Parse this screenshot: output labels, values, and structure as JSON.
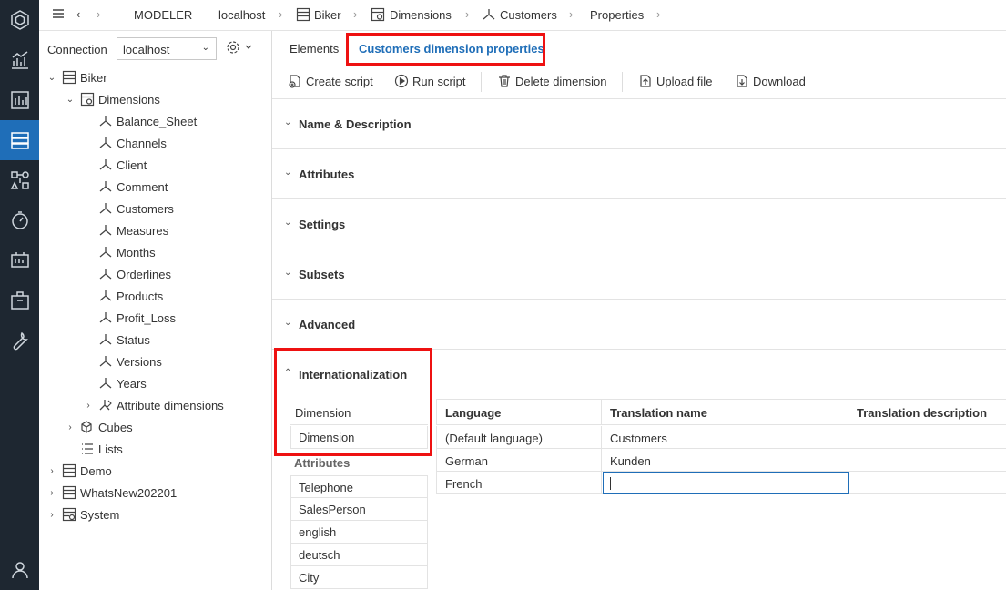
{
  "rail": {
    "items": [
      {
        "icon": "hexagon-logo-icon"
      },
      {
        "icon": "analytics-icon"
      },
      {
        "icon": "reports-icon"
      },
      {
        "icon": "modeler-icon",
        "active": true
      },
      {
        "icon": "designer-icon"
      },
      {
        "icon": "monitor-icon"
      },
      {
        "icon": "storyboard-icon"
      },
      {
        "icon": "package-icon"
      },
      {
        "icon": "tools-icon"
      },
      {
        "icon": "user-icon"
      }
    ]
  },
  "breadcrumb": {
    "modeler": "MODELER",
    "server": "localhost",
    "database": "Biker",
    "folder": "Dimensions",
    "dimension": "Customers",
    "page": "Properties"
  },
  "connection": {
    "label": "Connection",
    "value": "localhost"
  },
  "tree": {
    "biker": "Biker",
    "dimensions": "Dimensions",
    "dims": [
      "Balance_Sheet",
      "Channels",
      "Client",
      "Comment",
      "Customers",
      "Measures",
      "Months",
      "Orderlines",
      "Products",
      "Profit_Loss",
      "Status",
      "Versions",
      "Years"
    ],
    "attribute_dimensions": "Attribute dimensions",
    "cubes": "Cubes",
    "lists": "Lists",
    "demo": "Demo",
    "whatsnew": "WhatsNew202201",
    "system": "System"
  },
  "tabs": {
    "elements": "Elements",
    "properties": "Customers dimension properties"
  },
  "toolbar": {
    "create_script": "Create script",
    "run_script": "Run script",
    "delete_dimension": "Delete dimension",
    "upload_file": "Upload file",
    "download": "Download"
  },
  "sections": {
    "name_desc": "Name & Description",
    "attributes": "Attributes",
    "settings": "Settings",
    "subsets": "Subsets",
    "advanced": "Advanced",
    "internationalization": "Internationalization"
  },
  "intl": {
    "dimension_header": "Dimension",
    "dimension_item": "Dimension",
    "attributes_header": "Attributes",
    "attribute_items": [
      "Telephone",
      "SalesPerson",
      "english",
      "deutsch",
      "City"
    ],
    "columns": {
      "language": "Language",
      "translation_name": "Translation name",
      "translation_description": "Translation description"
    },
    "rows": [
      {
        "language": "(Default language)",
        "name": "Customers"
      },
      {
        "language": "German",
        "name": "Kunden"
      },
      {
        "language": "French",
        "name": ""
      }
    ]
  }
}
